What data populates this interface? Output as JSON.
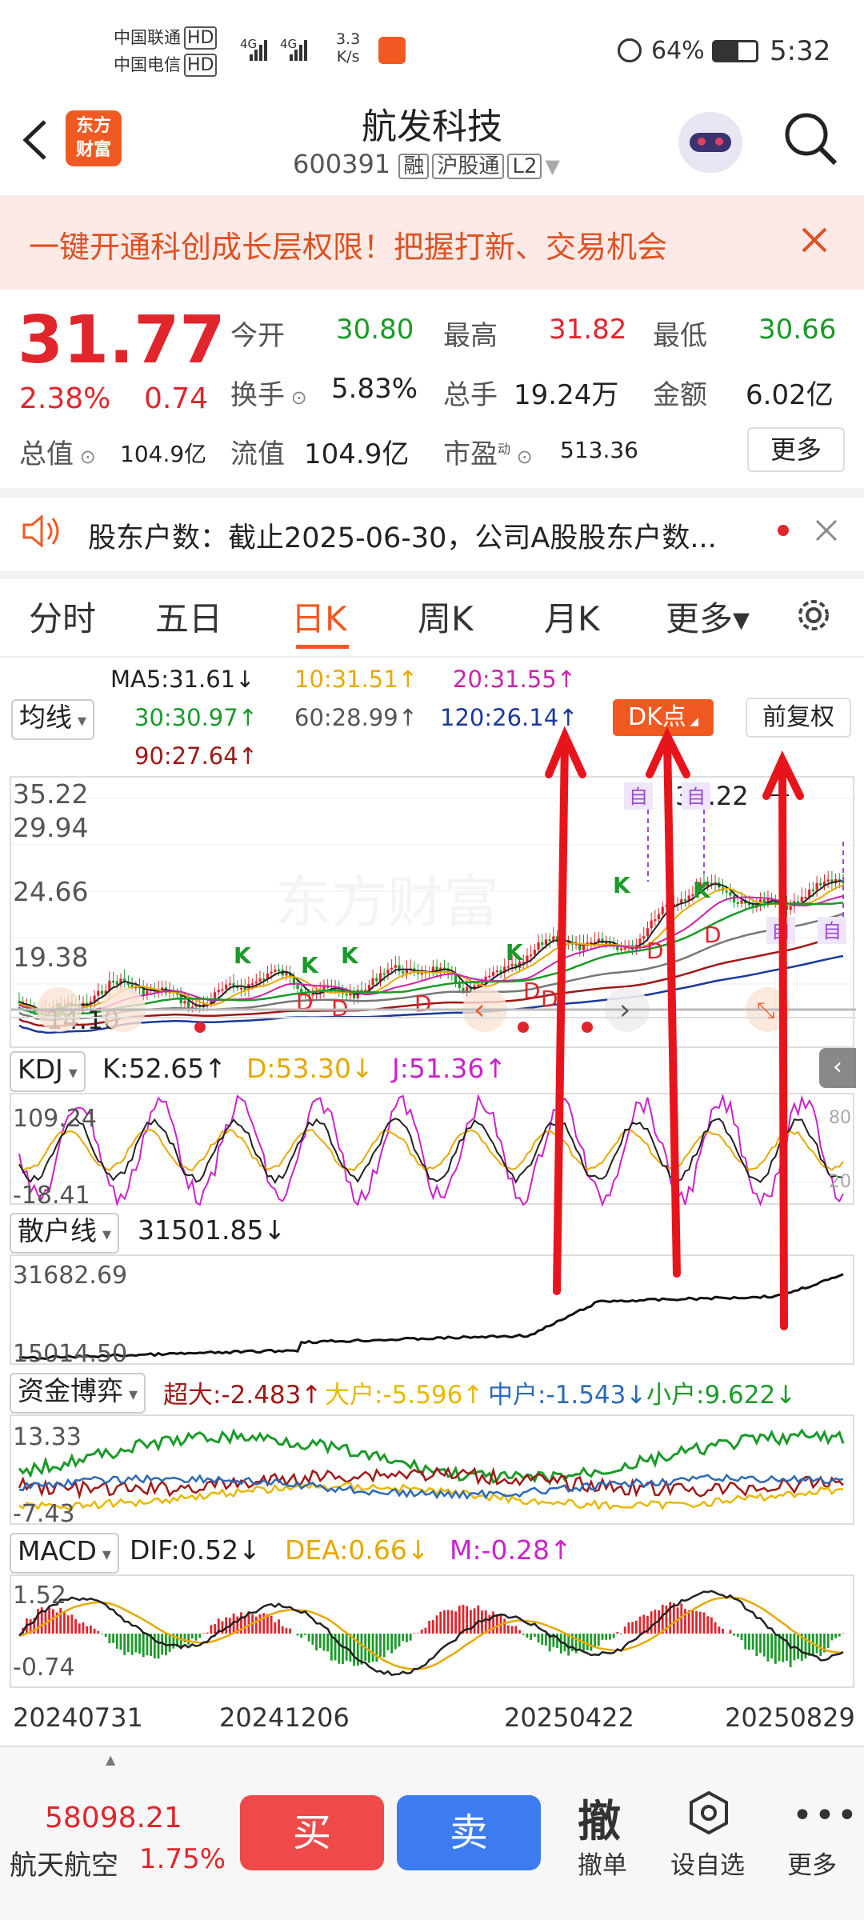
{
  "status_bar": {
    "carrier1": "中国联通",
    "carrier2": "中国电信",
    "hd": "HD",
    "net1": "4G",
    "net2": "4G",
    "speed1": "3.3",
    "speed2": "K/s",
    "battery": "64%",
    "time": "5:32"
  },
  "header": {
    "title": "航发科技",
    "code": "600391",
    "tags": [
      "融",
      "沪股通",
      "L2"
    ],
    "logo_line1": "东方",
    "logo_line2": "财富"
  },
  "banner": {
    "text": "一键开通科创成长层权限！把握打新、交易机会"
  },
  "quote": {
    "price": "31.77",
    "pct": "2.38%",
    "chg": "0.74",
    "rows": [
      [
        {
          "label": "今开",
          "value": "30.80",
          "color": "green"
        },
        {
          "label": "最高",
          "value": "31.82",
          "color": "red"
        },
        {
          "label": "最低",
          "value": "30.66",
          "color": "green"
        }
      ],
      [
        {
          "label": "换手",
          "value": "5.83%",
          "color": "dark"
        },
        {
          "label": "总手",
          "value": "19.24万",
          "color": "dark"
        },
        {
          "label": "金额",
          "value": "6.02亿",
          "color": "dark"
        }
      ]
    ],
    "total_label": "总值",
    "total_value": "104.9亿",
    "float_label": "流值",
    "float_value": "104.9亿",
    "pe_label": "市盈",
    "pe_sup": "动",
    "pe_value": "513.36",
    "more": "更多"
  },
  "notice": {
    "text": "股东户数：截止2025-06-30，公司A股股东户数..."
  },
  "tabs": [
    {
      "label": "分时",
      "active": false
    },
    {
      "label": "五日",
      "active": false
    },
    {
      "label": "日K",
      "active": true
    },
    {
      "label": "周K",
      "active": false
    },
    {
      "label": "月K",
      "active": false
    },
    {
      "label": "更多▾",
      "active": false
    }
  ],
  "ma": {
    "select": "均线",
    "ma5": "MA5:31.61↓",
    "ma10": "10:31.51↑",
    "ma20": "20:31.55↑",
    "ma30": "30:30.97↑",
    "ma60": "60:28.99↑",
    "ma120": "120:26.14↑",
    "ma90": "90:27.64↑",
    "dk_btn": "DK点",
    "fq_btn": "前复权"
  },
  "kline": {
    "y_labels": [
      "35.22",
      "29.94",
      "24.66",
      "19.38"
    ],
    "max_note": "35.22",
    "min_note": "14.10",
    "watermark": "东方财富",
    "marks_k": [
      "K",
      "K",
      "K",
      "K",
      "K",
      "K",
      "K"
    ],
    "marks_d": [
      "D",
      "D",
      "D",
      "D",
      "D",
      "D",
      "D"
    ],
    "marks_zi": [
      "自",
      "自",
      "自",
      "自"
    ],
    "pager_left": "‹",
    "pager_right": "›"
  },
  "kdj": {
    "select": "KDJ",
    "k": "K:52.65↑",
    "d": "D:53.30↓",
    "j": "J:51.36↑",
    "y_top": "109.24",
    "y_bot": "-18.41",
    "r80": "80",
    "r20": "20"
  },
  "retail": {
    "select": "散户线",
    "value": "31501.85↓",
    "y_top": "31682.69",
    "y_bot": "15014.50"
  },
  "fund": {
    "select": "资金博弈",
    "super": "超大:-2.483↑",
    "large": "大户:-5.596↑",
    "mid": "中户:-1.543↓",
    "small": "小户:9.622↓",
    "y_top": "13.33",
    "y_bot": "-7.43"
  },
  "macd": {
    "select": "MACD",
    "dif": "DIF:0.52↓",
    "dea": "DEA:0.66↓",
    "m": "M:-0.28↑",
    "y_top": "1.52",
    "y_bot": "-0.74"
  },
  "dates": [
    "20240731",
    "20241206",
    "20250422",
    "20250829"
  ],
  "bottom": {
    "index_value": "58098.21",
    "index_name": "航天航空",
    "index_pct": "1.75%",
    "buy": "买",
    "sell": "卖",
    "cancel_icon": "撤",
    "cancel": "撤单",
    "watch": "设自选",
    "more": "更多"
  },
  "colors": {
    "red": "#e0252c",
    "green": "#1a9a28",
    "orange": "#f05a22",
    "blue_btn": "#3d7cf0",
    "buy_btn": "#ee4a4a"
  }
}
